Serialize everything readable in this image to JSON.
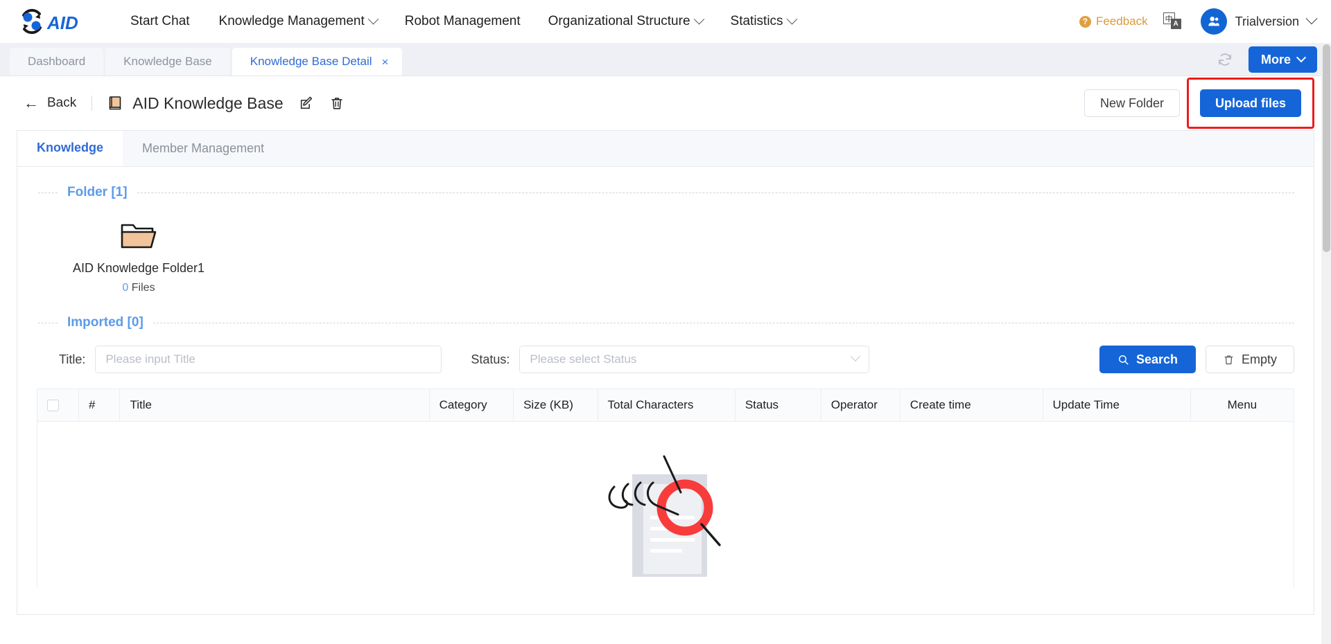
{
  "brand": {
    "logo_text": "AID",
    "accent_blue": "#1565d8",
    "logo_blue": "#1565d8"
  },
  "topnav": {
    "items": [
      {
        "label": "Start Chat",
        "has_caret": false
      },
      {
        "label": "Knowledge Management",
        "has_caret": true
      },
      {
        "label": "Robot Management",
        "has_caret": false
      },
      {
        "label": "Organizational Structure",
        "has_caret": true
      },
      {
        "label": "Statistics",
        "has_caret": true
      }
    ],
    "feedback_label": "Feedback",
    "feedback_icon": "question-circle-icon",
    "feedback_color": "#d99a3c",
    "language_icon": "language-switch-icon",
    "language_cn": "中",
    "language_en": "A",
    "avatar_icon": "user-avatar-icon",
    "username": "Trialversion",
    "user_caret": "chevron-down-icon"
  },
  "tabstrip": {
    "tabs": [
      {
        "label": "Dashboard",
        "active": false,
        "closable": false
      },
      {
        "label": "Knowledge Base",
        "active": false,
        "closable": false
      },
      {
        "label": "Knowledge Base Detail",
        "active": true,
        "closable": true
      }
    ],
    "close_glyph": "×",
    "refresh_icon": "refresh-icon",
    "more_label": "More",
    "more_caret": "chevron-down-icon"
  },
  "pagehead": {
    "back_label": "Back",
    "back_icon": "arrow-left-icon",
    "kb_icon": "book-icon",
    "title": "AID Knowledge Base",
    "edit_icon": "edit-pencil-icon",
    "delete_icon": "trash-icon",
    "new_folder_label": "New Folder",
    "upload_label": "Upload files",
    "highlight_color": "#ef1b1b"
  },
  "subtabs": [
    {
      "label": "Knowledge",
      "active": true
    },
    {
      "label": "Member Management",
      "active": false
    }
  ],
  "folder_section": {
    "title": "Folder [1]",
    "items": [
      {
        "name": "AID Knowledge Folder1",
        "count": "0",
        "count_suffix": "Files",
        "icon": "folder-icon"
      }
    ]
  },
  "imported_section": {
    "title": "Imported [0]",
    "filters": {
      "title_label": "Title:",
      "title_value": "",
      "title_placeholder": "Please input Title",
      "status_label": "Status:",
      "status_value": "",
      "status_placeholder": "Please select Status",
      "status_caret": "chevron-down-icon"
    },
    "search_label": "Search",
    "search_icon": "search-icon",
    "empty_label": "Empty",
    "empty_icon": "trash-icon"
  },
  "table": {
    "select_all_icon": "checkbox-unchecked-icon",
    "columns": [
      "#",
      "Title",
      "Category",
      "Size (KB)",
      "Total Characters",
      "Status",
      "Operator",
      "Create time",
      "Update Time",
      "Menu"
    ],
    "rows": [],
    "empty_illustration": "no-data-search-document-illustration"
  }
}
